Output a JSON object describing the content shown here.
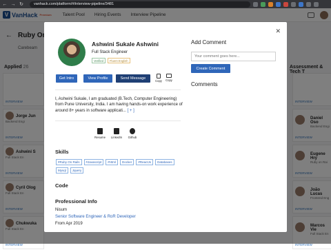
{
  "browser": {
    "url": "vanhack.com/platform/#/interview-pipeline/3481"
  },
  "app": {
    "logo": "VanHack",
    "logo_sub": "Premium",
    "nav": [
      "Talent Pool",
      "Hiring Events",
      "Interview Pipeline"
    ]
  },
  "background": {
    "title": "Ruby On R",
    "subtitle": "Carebeam",
    "applied_label": "Applied",
    "applied_count": "26",
    "assessment_label": "Assessment & Tech T",
    "left_cards": [
      {
        "name": "",
        "role": "",
        "status": "INTERVIEW"
      },
      {
        "name": "Jorge Jun",
        "role": "Backend Engi",
        "status": "INTERVIEW"
      },
      {
        "name": "Ashwini S",
        "role": "Full Stack En",
        "status": "INTERVIEW"
      },
      {
        "name": "Cyril Olog",
        "role": "Full Stack En",
        "status": "INTERVIEW"
      },
      {
        "name": "Chukwuka",
        "role": "Full Stack En",
        "status": "INTERVIEW"
      }
    ],
    "right_cards": [
      {
        "name": "",
        "role": "",
        "status": "INTERVIEW"
      },
      {
        "name": "Daniel Oso",
        "role": "Backend Engi",
        "status": "INTERVIEW"
      },
      {
        "name": "Eugene Hry",
        "role": "Ruby on Rai",
        "status": "INTERVIEW"
      },
      {
        "name": "João Lucas",
        "role": "Frontend Eng",
        "status": "INTERVIEW"
      },
      {
        "name": "Marcos Vie",
        "role": "Full Stack En",
        "status": "INTERVIEW"
      }
    ]
  },
  "modal": {
    "name": "Ashwini Sukale Ashwini",
    "role": "Full Stack Engineer",
    "tags": [
      "Verified",
      "Fluent English"
    ],
    "buttons": {
      "intro": "Get Intro",
      "profile": "View Profile",
      "message": "Send Message"
    },
    "copy_label": "Copy",
    "bio": "I, Ashwini Sukale, I am graduated (B.Tech, Computer Engineering) from Pune University, India. I am having hands-on work experience of around 8+ years in software applicati...",
    "bio_more": "[ + ]",
    "links": [
      "Resume",
      "LinkedIn",
      "Github"
    ],
    "skills_title": "Skills",
    "skills": [
      "#Ruby On Rails",
      "#Javascript",
      "#Html",
      "Docker",
      "#ReactJs",
      "Databases",
      "Mysql",
      "Jquery"
    ],
    "code_title": "Code",
    "professional_title": "Professional Info",
    "company": "Nisum",
    "position": "Senior Software Engineer & RoR Developer",
    "since": "From Apr 2019",
    "add_comment_title": "Add Comment",
    "comment_placeholder": "Your comment goes here...",
    "create_comment": "Create Comment",
    "comments_title": "Comments"
  }
}
